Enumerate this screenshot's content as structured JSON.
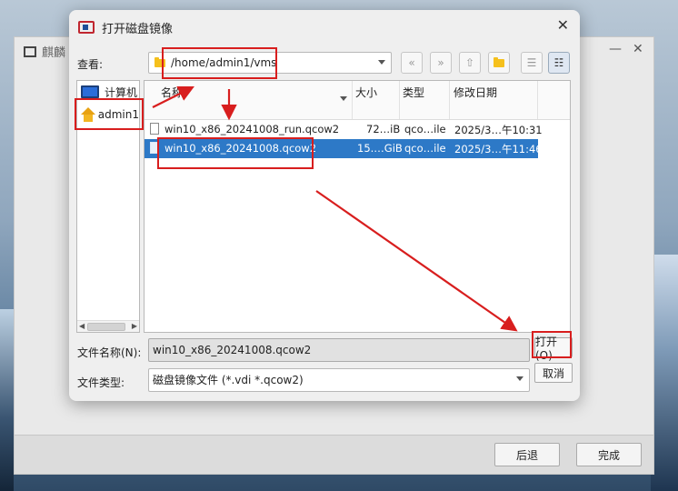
{
  "background_window": {
    "title": "麒麟",
    "back_button": "后退",
    "finish_button": "完成"
  },
  "dialog": {
    "title": "打开磁盘镜像",
    "look_in_label": "查看:",
    "path": "/home/admin1/vms",
    "toolbar": [
      "back-icon",
      "forward-icon",
      "up-icon",
      "new-folder-icon",
      "list-view-icon",
      "detail-view-icon"
    ],
    "sidebar": {
      "items": [
        {
          "label": "计算机",
          "icon": "monitor-icon"
        },
        {
          "label": "admin1",
          "icon": "home-icon"
        }
      ]
    },
    "columns": {
      "name": "名称",
      "size": "大小",
      "type": "类型",
      "modified": "修改日期"
    },
    "files": [
      {
        "name": "win10_x86_20241008_run.qcow2",
        "size": "72…iB",
        "type": "qco…ile",
        "modified": "2025/3…午10:31",
        "selected": false
      },
      {
        "name": "win10_x86_20241008.qcow2",
        "size": "15.…GiB",
        "type": "qco…ile",
        "modified": "2025/3…午11:46",
        "selected": true
      }
    ],
    "filename_label": "文件名称(N):",
    "filename_value": "win10_x86_20241008.qcow2",
    "filetype_label": "文件类型:",
    "filetype_value": "磁盘镜像文件 (*.vdi *.qcow2)",
    "open_button": "打开(O)",
    "cancel_button": "取消"
  },
  "colors": {
    "annotation": "#d81e1e",
    "selection": "#2d79c7"
  }
}
